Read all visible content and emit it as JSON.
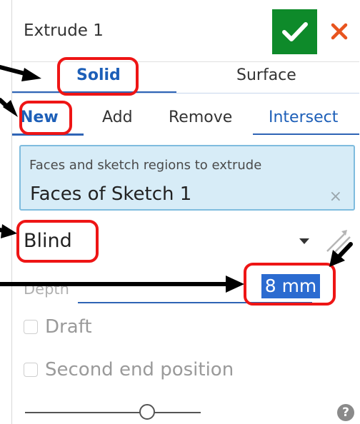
{
  "header": {
    "title": "Extrude 1",
    "ok_icon": "check-icon",
    "cancel_icon": "close-icon",
    "ok_color": "#0e8a2a",
    "cancel_color": "#e8541e"
  },
  "body_type_tabs": [
    {
      "label": "Solid",
      "active": true
    },
    {
      "label": "Surface",
      "active": false
    }
  ],
  "operation_tabs": [
    {
      "label": "New",
      "active": true
    },
    {
      "label": "Add",
      "active": false
    },
    {
      "label": "Remove",
      "active": false
    },
    {
      "label": "Intersect",
      "active": false
    }
  ],
  "faces": {
    "label": "Faces and sketch regions to extrude",
    "value": "Faces of Sketch 1",
    "clear_glyph": "×"
  },
  "end_type": {
    "value": "Blind",
    "dropdown_icon": "caret-down-icon",
    "flip_icon": "flip-direction-icon"
  },
  "depth": {
    "label": "Depth",
    "value": "8 mm"
  },
  "options": {
    "draft_label": "Draft",
    "second_end_label": "Second end position",
    "draft_checked": false,
    "second_end_checked": false
  },
  "footer": {
    "help_glyph": "?",
    "help_icon": "help-icon"
  },
  "colors": {
    "accent": "#2f64b5",
    "highlight_box": "#ee1515",
    "faces_bg": "#d7ecf7"
  }
}
